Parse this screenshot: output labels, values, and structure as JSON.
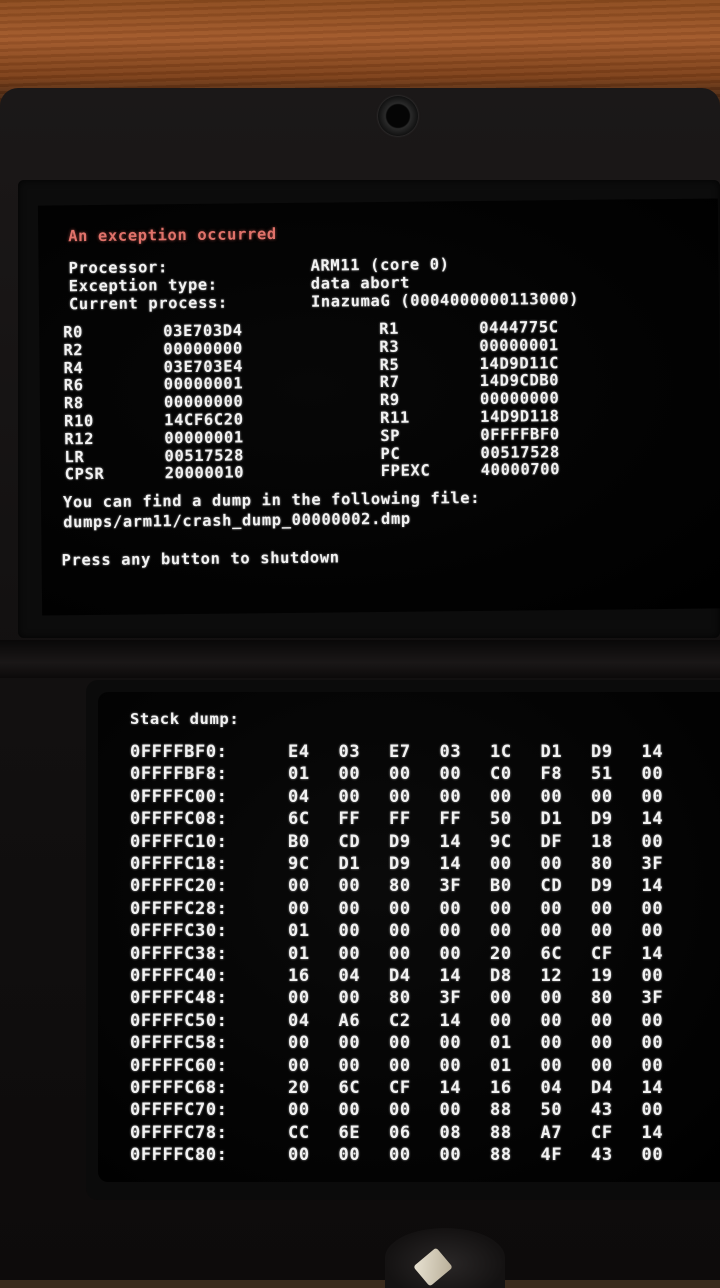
{
  "top_screen": {
    "title": "An exception occurred",
    "info": [
      {
        "label": "Processor:",
        "value": "ARM11 (core 0)"
      },
      {
        "label": "Exception type:",
        "value": "data abort"
      },
      {
        "label": "Current process:",
        "value": "InazumaG (0004000000113000)"
      }
    ],
    "registers": [
      {
        "left_name": "R0",
        "left_value": "03E703D4",
        "right_name": "R1",
        "right_value": "0444775C"
      },
      {
        "left_name": "R2",
        "left_value": "00000000",
        "right_name": "R3",
        "right_value": "00000001"
      },
      {
        "left_name": "R4",
        "left_value": "03E703E4",
        "right_name": "R5",
        "right_value": "14D9D11C"
      },
      {
        "left_name": "R6",
        "left_value": "00000001",
        "right_name": "R7",
        "right_value": "14D9CDB0"
      },
      {
        "left_name": "R8",
        "left_value": "00000000",
        "right_name": "R9",
        "right_value": "00000000"
      },
      {
        "left_name": "R10",
        "left_value": "14CF6C20",
        "right_name": "R11",
        "right_value": "14D9D118"
      },
      {
        "left_name": "R12",
        "left_value": "00000001",
        "right_name": "SP",
        "right_value": "0FFFFBF0"
      },
      {
        "left_name": "LR",
        "left_value": "00517528",
        "right_name": "PC",
        "right_value": "00517528"
      },
      {
        "left_name": "CPSR",
        "left_value": "20000010",
        "right_name": "FPEXC",
        "right_value": "40000700"
      }
    ],
    "dump_message": "You can find a dump in the following file:",
    "dump_path": "dumps/arm11/crash_dump_00000002.dmp",
    "shutdown_prompt": "Press any button to shutdown"
  },
  "bottom_screen": {
    "title": "Stack dump:",
    "rows": [
      {
        "address": "0FFFFBF0:",
        "bytes": [
          "E4",
          "03",
          "E7",
          "03",
          "1C",
          "D1",
          "D9",
          "14"
        ]
      },
      {
        "address": "0FFFFBF8:",
        "bytes": [
          "01",
          "00",
          "00",
          "00",
          "C0",
          "F8",
          "51",
          "00"
        ]
      },
      {
        "address": "0FFFFC00:",
        "bytes": [
          "04",
          "00",
          "00",
          "00",
          "00",
          "00",
          "00",
          "00"
        ]
      },
      {
        "address": "0FFFFC08:",
        "bytes": [
          "6C",
          "FF",
          "FF",
          "FF",
          "50",
          "D1",
          "D9",
          "14"
        ]
      },
      {
        "address": "0FFFFC10:",
        "bytes": [
          "B0",
          "CD",
          "D9",
          "14",
          "9C",
          "DF",
          "18",
          "00"
        ]
      },
      {
        "address": "0FFFFC18:",
        "bytes": [
          "9C",
          "D1",
          "D9",
          "14",
          "00",
          "00",
          "80",
          "3F"
        ]
      },
      {
        "address": "0FFFFC20:",
        "bytes": [
          "00",
          "00",
          "80",
          "3F",
          "B0",
          "CD",
          "D9",
          "14"
        ]
      },
      {
        "address": "0FFFFC28:",
        "bytes": [
          "00",
          "00",
          "00",
          "00",
          "00",
          "00",
          "00",
          "00"
        ]
      },
      {
        "address": "0FFFFC30:",
        "bytes": [
          "01",
          "00",
          "00",
          "00",
          "00",
          "00",
          "00",
          "00"
        ]
      },
      {
        "address": "0FFFFC38:",
        "bytes": [
          "01",
          "00",
          "00",
          "00",
          "20",
          "6C",
          "CF",
          "14"
        ]
      },
      {
        "address": "0FFFFC40:",
        "bytes": [
          "16",
          "04",
          "D4",
          "14",
          "D8",
          "12",
          "19",
          "00"
        ]
      },
      {
        "address": "0FFFFC48:",
        "bytes": [
          "00",
          "00",
          "80",
          "3F",
          "00",
          "00",
          "80",
          "3F"
        ]
      },
      {
        "address": "0FFFFC50:",
        "bytes": [
          "04",
          "A6",
          "C2",
          "14",
          "00",
          "00",
          "00",
          "00"
        ]
      },
      {
        "address": "0FFFFC58:",
        "bytes": [
          "00",
          "00",
          "00",
          "00",
          "01",
          "00",
          "00",
          "00"
        ]
      },
      {
        "address": "0FFFFC60:",
        "bytes": [
          "00",
          "00",
          "00",
          "00",
          "01",
          "00",
          "00",
          "00"
        ]
      },
      {
        "address": "0FFFFC68:",
        "bytes": [
          "20",
          "6C",
          "CF",
          "14",
          "16",
          "04",
          "D4",
          "14"
        ]
      },
      {
        "address": "0FFFFC70:",
        "bytes": [
          "00",
          "00",
          "00",
          "00",
          "88",
          "50",
          "43",
          "00"
        ]
      },
      {
        "address": "0FFFFC78:",
        "bytes": [
          "CC",
          "6E",
          "06",
          "08",
          "88",
          "A7",
          "CF",
          "14"
        ]
      },
      {
        "address": "0FFFFC80:",
        "bytes": [
          "00",
          "00",
          "00",
          "00",
          "88",
          "4F",
          "43",
          "00"
        ]
      }
    ]
  }
}
